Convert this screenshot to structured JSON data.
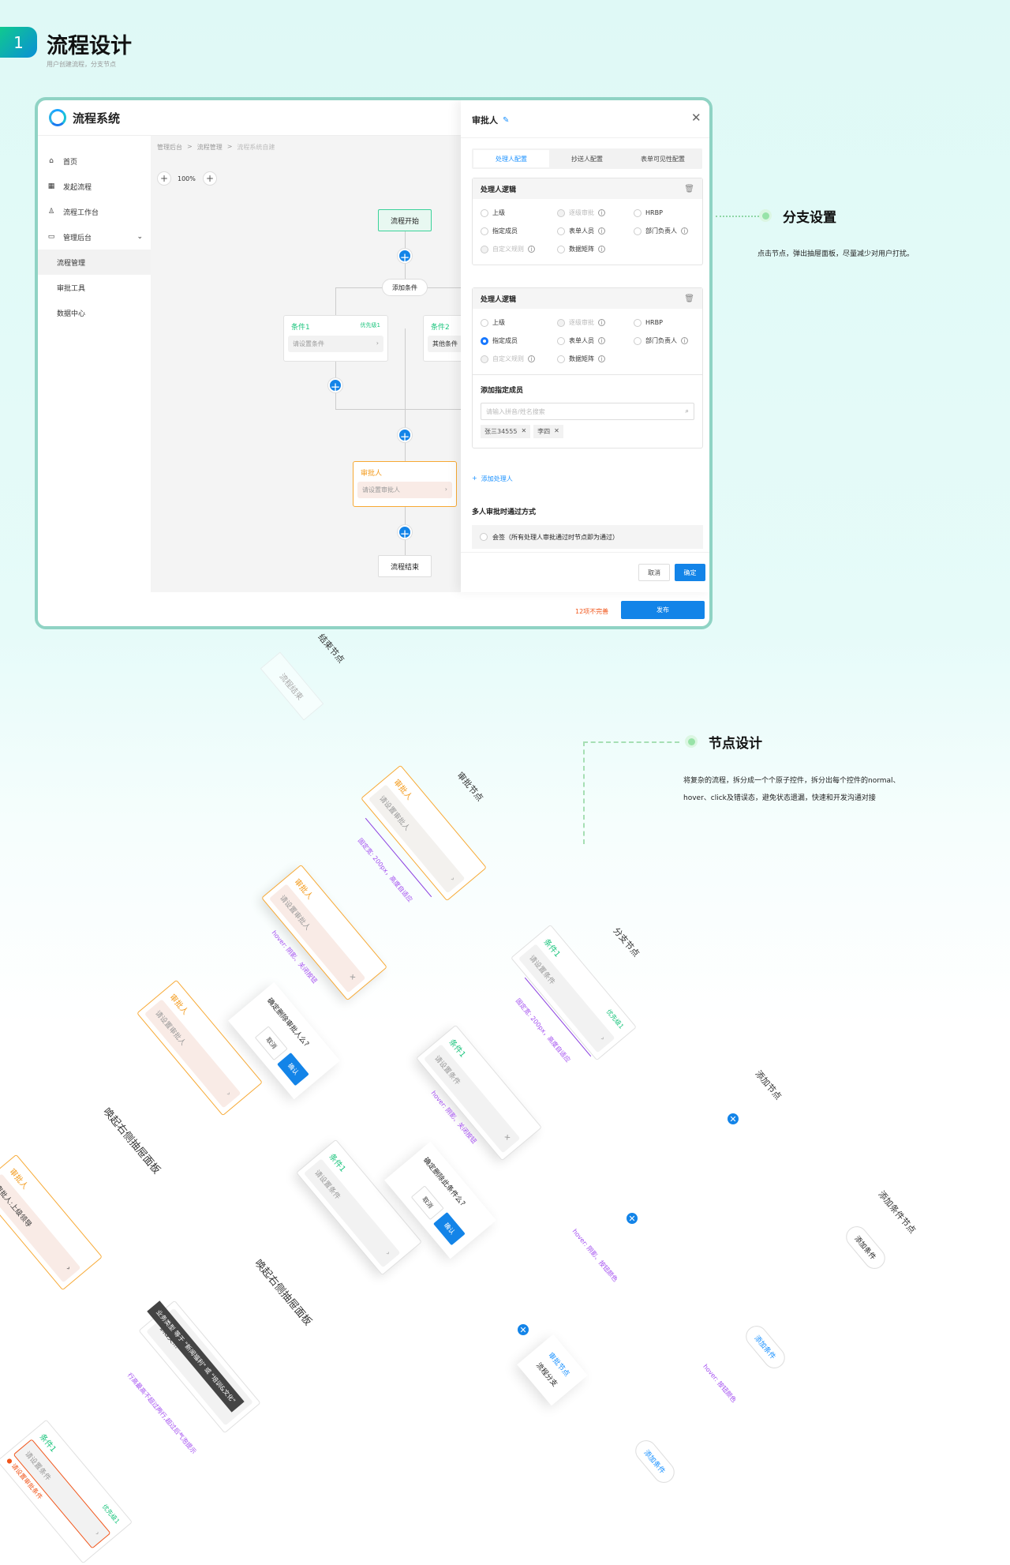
{
  "header": {
    "step": "1",
    "title": "流程设计",
    "subtitle": "用户创建流程，分支节点"
  },
  "app": {
    "name": "流程系统",
    "sidebar": [
      {
        "label": "首页",
        "icon": "⌂"
      },
      {
        "label": "发起流程",
        "icon": "▦"
      },
      {
        "label": "流程工作台",
        "icon": "♙"
      },
      {
        "label": "管理后台",
        "icon": "▭",
        "chevron": "⌄"
      },
      {
        "label": "流程管理"
      },
      {
        "label": "审批工具"
      },
      {
        "label": "数据中心"
      }
    ],
    "breadcrumb": [
      "管理后台",
      "流程管理",
      "流程系统自建"
    ],
    "breadcrumb_sep": ">",
    "zoom": "100%",
    "flow": {
      "start": "流程开始",
      "add_condition": "添加条件",
      "cond1": {
        "title": "条件1",
        "priority": "优先级1",
        "placeholder": "请设置条件"
      },
      "cond2": {
        "title": "条件2",
        "text": "其他条件"
      },
      "approver": {
        "title": "审批人",
        "placeholder": "请设置审批人"
      },
      "end": "流程结束"
    },
    "drawer": {
      "title": "审批人",
      "tabs": [
        "处理人配置",
        "抄送人配置",
        "表单可见性配置"
      ],
      "section_title": "处理人逻辑",
      "options": [
        {
          "label": "上级"
        },
        {
          "label": "逐级审批",
          "disabled": true,
          "info": true
        },
        {
          "label": "HRBP"
        },
        {
          "label": "指定成员"
        },
        {
          "label": "表单人员",
          "info": true
        },
        {
          "label": "部门负责人",
          "info": true
        },
        {
          "label": "自定义规则",
          "disabled": true,
          "info": true
        },
        {
          "label": "数据矩阵",
          "info": true
        }
      ],
      "section2_selected": "指定成员",
      "add_member_title": "添加指定成员",
      "search_placeholder": "请输入拼音/姓名搜索",
      "tags": [
        "张三34555",
        "李四"
      ],
      "add_handler": "添加处理人",
      "multi_title": "多人审批时通过方式",
      "multi_option": "会签（所有处理人审批通过时节点即为通过）",
      "cancel": "取消",
      "confirm": "确定"
    },
    "footer": {
      "warning": "12项不完善",
      "publish": "发布"
    }
  },
  "annotations": {
    "branch": {
      "title": "分支设置",
      "desc": "点击节点，弹出抽屉面板，尽量减少对用户打扰。"
    },
    "node": {
      "title": "节点设计",
      "desc1": "将复杂的流程，拆分成一个个原子控件，拆分出每个控件的normal、",
      "desc2": "hover、click及错误态，避免状态遗漏，快速和开发沟通对接"
    }
  },
  "showcase": {
    "rows": [
      "结束节点",
      "审批节点",
      "分支节点",
      "添加节点",
      "添加条件节点"
    ],
    "end_node": "流程结束",
    "approver_title": "审批人",
    "approver_placeholder": "请设置审批人",
    "approver_filled": "审批人:上级领导",
    "fixed_width_note": "固定宽: 200px，高度自适应",
    "hover_close_note": "hover: 阴影、关闭按钮",
    "hover_btn_note": "hover: 阴影、按钮颜色",
    "hover_color_note": "hover: 按钮颜色",
    "delete_approver": "确定删除审批人么?",
    "delete_condition": "确定删除此条件么?",
    "cancel": "取消",
    "ok": "确认",
    "drawer_note": "唤起右侧抽屉面板",
    "cond_title": "条件1",
    "cond_priority": "优先级1",
    "cond_placeholder": "请设置条件",
    "tooltip": "业务类型 等于 \"新闻福利\" 或 \"培训&文化\"",
    "tooltip_card": "业务类型 等于 \"新闻福利\" 或 \"培训&文...",
    "line_note": "行高最高不超过两行,超过后气泡提示",
    "error_text": "请设置审批条件",
    "menu": [
      "审批节点",
      "流程分支"
    ],
    "add_condition": "添加条件"
  },
  "colors": {
    "primary": "#1384e8",
    "green": "#1bc47d",
    "orange": "#f39a1b",
    "purple": "#a34ef0",
    "frame": "#8fd3c4",
    "error": "#f1561b"
  }
}
